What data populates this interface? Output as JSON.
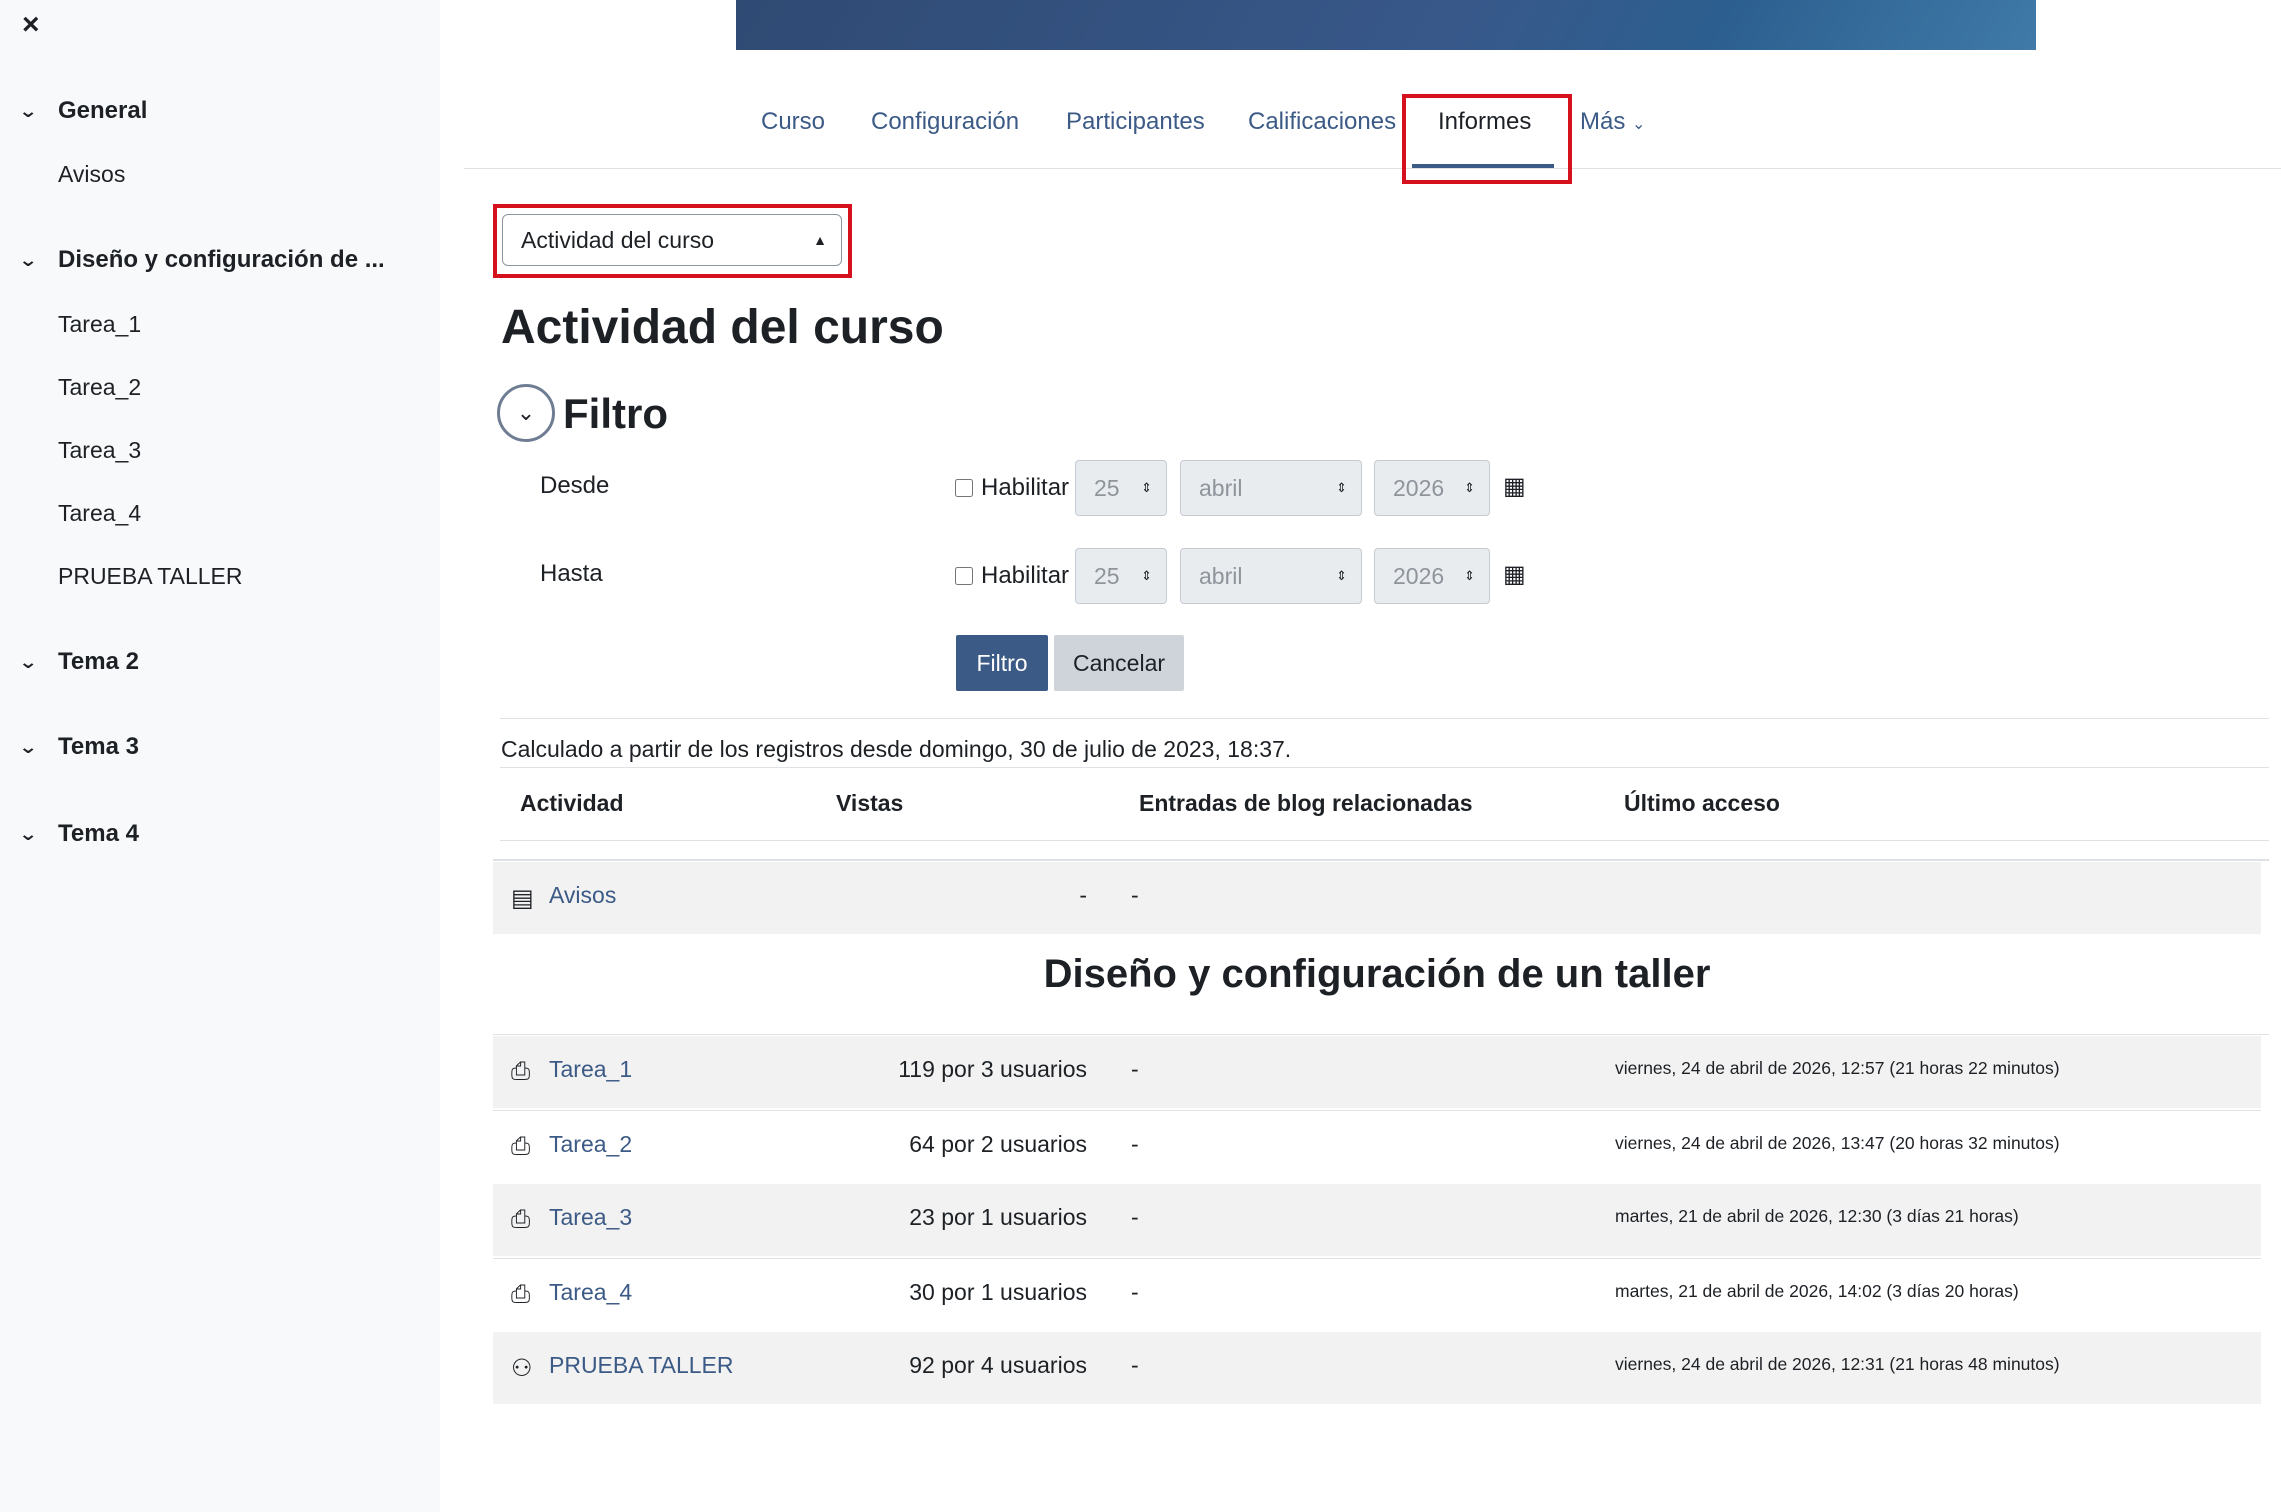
{
  "sidebar": {
    "close_icon": "×",
    "sections": [
      {
        "title": "General",
        "items": [
          "Avisos"
        ]
      },
      {
        "title": "Diseño y configuración de ...",
        "items": [
          "Tarea_1",
          "Tarea_2",
          "Tarea_3",
          "Tarea_4",
          "PRUEBA TALLER"
        ]
      },
      {
        "title": "Tema 2",
        "items": []
      },
      {
        "title": "Tema 3",
        "items": []
      },
      {
        "title": "Tema 4",
        "items": []
      }
    ]
  },
  "nav": {
    "tabs": [
      "Curso",
      "Configuración",
      "Participantes",
      "Calificaciones",
      "Informes",
      "Más"
    ],
    "active": "Informes"
  },
  "report_select": {
    "value": "Actividad del curso"
  },
  "page_title": "Actividad del curso",
  "filter": {
    "title": "Filtro",
    "from_label": "Desde",
    "to_label": "Hasta",
    "enable_label": "Habilitar",
    "day": "25",
    "month": "abril",
    "year": "2026",
    "filter_button": "Filtro",
    "cancel_button": "Cancelar"
  },
  "calculated_text": "Calculado a partir de los registros desde domingo, 30 de julio de 2023, 18:37.",
  "table": {
    "headers": [
      "Actividad",
      "Vistas",
      "Entradas de blog relacionadas",
      "Último acceso"
    ],
    "top_rows": [
      {
        "icon": "forum-icon",
        "name": "Avisos",
        "views": "-",
        "blog": "-",
        "last": ""
      }
    ],
    "section_heading": "Diseño y configuración de un taller",
    "rows": [
      {
        "icon": "assignment-icon",
        "name": "Tarea_1",
        "views": "119 por 3 usuarios",
        "blog": "-",
        "last": "viernes, 24 de abril de 2026, 12:57 (21 horas 22 minutos)"
      },
      {
        "icon": "assignment-icon",
        "name": "Tarea_2",
        "views": "64 por 2 usuarios",
        "blog": "-",
        "last": "viernes, 24 de abril de 2026, 13:47 (20 horas 32 minutos)"
      },
      {
        "icon": "assignment-icon",
        "name": "Tarea_3",
        "views": "23 por 1 usuarios",
        "blog": "-",
        "last": "martes, 21 de abril de 2026, 12:30 (3 días 21 horas)"
      },
      {
        "icon": "assignment-icon",
        "name": "Tarea_4",
        "views": "30 por 1 usuarios",
        "blog": "-",
        "last": "martes, 21 de abril de 2026, 14:02 (3 días 20 horas)"
      },
      {
        "icon": "workshop-icon",
        "name": "PRUEBA TALLER",
        "views": "92 por 4 usuarios",
        "blog": "-",
        "last": "viernes, 24 de abril de 2026, 12:31 (21 horas 48 minutos)"
      }
    ]
  },
  "colors": {
    "accent": "#3c5a86",
    "highlight": "#d4111d",
    "sidebar_bg": "#f8f9fa"
  }
}
